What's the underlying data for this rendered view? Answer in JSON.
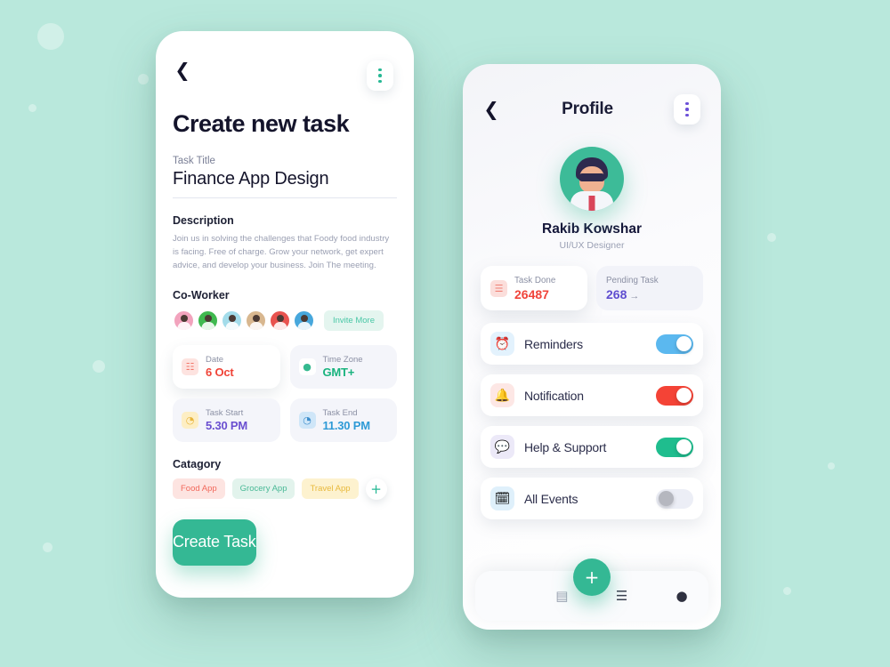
{
  "theme": {
    "background": "#b9e8dc",
    "accent_green": "#34b894",
    "card_white": "#ffffff"
  },
  "create_task_screen": {
    "back_icon": "chevron-left-icon",
    "menu_icon": "kebab-menu-icon",
    "title": "Create new task",
    "task_title": {
      "label": "Task Title",
      "value": "Finance App Design"
    },
    "description": {
      "label": "Description",
      "text": "Join us in solving the challenges that Foody food industry is facing. Free of charge. Grow your network, get expert advice, and develop your business. Join The meeting."
    },
    "coworker": {
      "label": "Co-Worker",
      "avatars": [
        {
          "name": "coworker-1",
          "color": "#f4a8c0"
        },
        {
          "name": "coworker-2",
          "color": "#3fb94f"
        },
        {
          "name": "coworker-3",
          "color": "#9fdbe8"
        },
        {
          "name": "coworker-4",
          "color": "#d9b690"
        },
        {
          "name": "coworker-5",
          "color": "#e8projection"
        },
        {
          "name": "coworker-6",
          "color": "#4aa8dd"
        }
      ],
      "invite_label": "Invite More"
    },
    "schedule_cards": [
      {
        "icon": "calendar-icon",
        "glyph": "☷",
        "icon_bg": "#fde3e0",
        "icon_color": "#f2776a",
        "label": "Date",
        "value": "6 Oct",
        "value_color": "#f04438",
        "style": "white"
      },
      {
        "icon": "globe-icon",
        "glyph": "●",
        "icon_bg": "#ffffff",
        "icon_color": "#35b98f",
        "label": "Time Zone",
        "value": "GMT+",
        "value_color": "#19b37e",
        "style": "tint"
      },
      {
        "icon": "clock-icon",
        "glyph": "◔",
        "icon_bg": "#fdeec4",
        "icon_color": "#e8b53c",
        "label": "Task Start",
        "value": "5.30 PM",
        "value_color": "#6a4fd0",
        "style": "tint"
      },
      {
        "icon": "clock-icon",
        "glyph": "◔",
        "icon_bg": "#cfe6f8",
        "icon_color": "#3d8ecc",
        "label": "Task End",
        "value": "11.30 PM",
        "value_color": "#2e9ad6",
        "style": "tint"
      }
    ],
    "category": {
      "label": "Catagory",
      "chips": [
        {
          "label": "Food App",
          "bg": "#fde4e1",
          "color": "#f2695c"
        },
        {
          "label": "Grocery App",
          "bg": "#e2f3ec",
          "color": "#49b996"
        },
        {
          "label": "Travel App",
          "bg": "#fdf2cf",
          "color": "#e8b93c"
        }
      ],
      "add_icon": "plus-icon",
      "add_glyph": "+"
    },
    "submit_label": "Create Task"
  },
  "profile_screen": {
    "back_icon": "chevron-left-icon",
    "menu_icon": "kebab-menu-icon",
    "title": "Profile",
    "avatar_name": "user-avatar",
    "user_name": "Rakib Kowshar",
    "user_role": "UI/UX Designer",
    "stats": [
      {
        "icon": "clipboard-icon",
        "glyph": "☰",
        "icon_bg": "#fbdedb",
        "icon_color": "#ef8076",
        "label": "Task Done",
        "value": "26487",
        "value_color": "#f0443a",
        "style": "white"
      },
      {
        "icon": "arrow-right-icon",
        "glyph": "→",
        "label": "Pending Task",
        "value": "268",
        "value_color": "#5f4ed0",
        "style": "tint"
      }
    ],
    "settings": [
      {
        "icon": "alarm-clock-icon",
        "glyph": "⏰",
        "icon_bg": "#e3f2fd",
        "label": "Reminders",
        "toggle": "on",
        "toggle_color": "#5bb8ef"
      },
      {
        "icon": "bell-icon",
        "glyph": "🔔",
        "icon_bg": "#fde7e5",
        "label": "Notification",
        "toggle": "on",
        "toggle_color": "#f44336"
      },
      {
        "icon": "chat-bubble-icon",
        "glyph": "💬",
        "icon_bg": "#ece9f8",
        "label": "Help & Support",
        "toggle": "on",
        "toggle_color": "#1fbd8e"
      },
      {
        "icon": "calendar-events-icon",
        "glyph": "🗓",
        "icon_bg": "#dff0fb",
        "label": "All Events",
        "toggle": "off",
        "toggle_color": "#eceef6"
      }
    ],
    "bottom_nav": {
      "items": [
        {
          "name": "nav-dashboard",
          "icon": "grid-icon",
          "glyph": "",
          "active": true
        },
        {
          "name": "nav-calendar",
          "icon": "calendar-icon",
          "glyph": "▤",
          "active": false
        },
        {
          "name": "nav-list",
          "icon": "list-icon",
          "glyph": "☰",
          "active": false
        },
        {
          "name": "nav-profile",
          "icon": "person-icon",
          "glyph": "●",
          "active": false
        }
      ],
      "fab_icon": "plus-icon",
      "fab_glyph": "+"
    }
  }
}
